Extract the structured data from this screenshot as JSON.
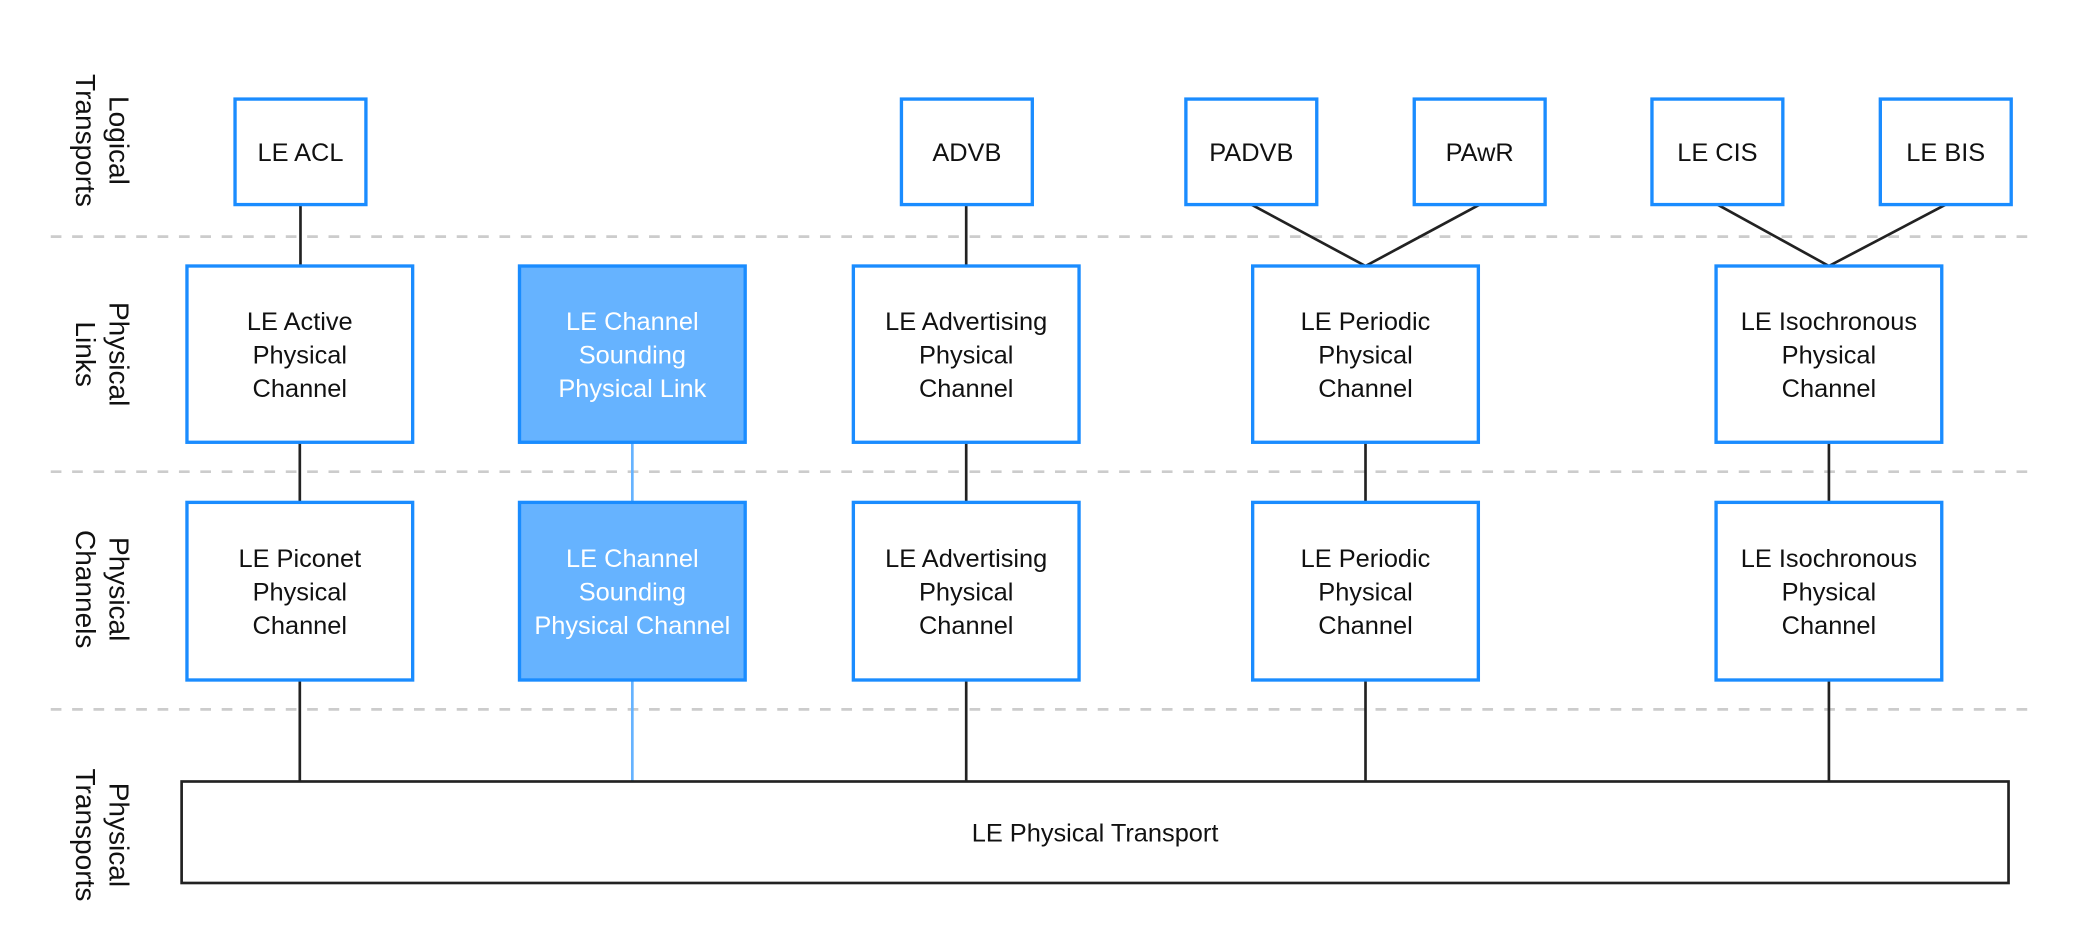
{
  "colors": {
    "box_border": "#1a8cff",
    "highlight_fill": "#66b3ff",
    "highlight_line": "#66b3ff",
    "line": "#222222",
    "divider": "#cccccc"
  },
  "row_labels": [
    [
      "Logical",
      "Transports"
    ],
    [
      "Physical",
      "Links"
    ],
    [
      "Physical",
      "Channels"
    ],
    [
      "Physical",
      "Transports"
    ]
  ],
  "logical_transports": [
    {
      "id": "le-acl",
      "label": [
        "LE ACL"
      ]
    },
    {
      "id": "advb",
      "label": [
        "ADVB"
      ]
    },
    {
      "id": "padvb",
      "label": [
        "PADVB"
      ]
    },
    {
      "id": "pawr",
      "label": [
        "PAwR"
      ]
    },
    {
      "id": "le-cis",
      "label": [
        "LE CIS"
      ]
    },
    {
      "id": "le-bis",
      "label": [
        "LE BIS"
      ]
    }
  ],
  "physical_links": [
    {
      "id": "le-active-physical-channel",
      "label": [
        "LE Active",
        "Physical",
        "Channel"
      ],
      "highlighted": false
    },
    {
      "id": "le-cs-physical-link",
      "label": [
        "LE Channel",
        "Sounding",
        "Physical Link"
      ],
      "highlighted": true
    },
    {
      "id": "le-advertising-physical-channel-link",
      "label": [
        "LE Advertising",
        "Physical",
        "Channel"
      ],
      "highlighted": false
    },
    {
      "id": "le-periodic-physical-channel-link",
      "label": [
        "LE Periodic",
        "Physical",
        "Channel"
      ],
      "highlighted": false
    },
    {
      "id": "le-isochronous-physical-channel-link",
      "label": [
        "LE Isochronous",
        "Physical",
        "Channel"
      ],
      "highlighted": false
    }
  ],
  "physical_channels": [
    {
      "id": "le-piconet-physical-channel",
      "label": [
        "LE Piconet",
        "Physical",
        "Channel"
      ],
      "highlighted": false
    },
    {
      "id": "le-cs-physical-channel",
      "label": [
        "LE Channel",
        "Sounding",
        "Physical Channel"
      ],
      "highlighted": true
    },
    {
      "id": "le-advertising-physical-channel",
      "label": [
        "LE Advertising",
        "Physical",
        "Channel"
      ],
      "highlighted": false
    },
    {
      "id": "le-periodic-physical-channel",
      "label": [
        "LE Periodic",
        "Physical",
        "Channel"
      ],
      "highlighted": false
    },
    {
      "id": "le-isochronous-physical-channel",
      "label": [
        "LE Isochronous",
        "Physical",
        "Channel"
      ],
      "highlighted": false
    }
  ],
  "physical_transport": {
    "label": "LE Physical Transport"
  }
}
